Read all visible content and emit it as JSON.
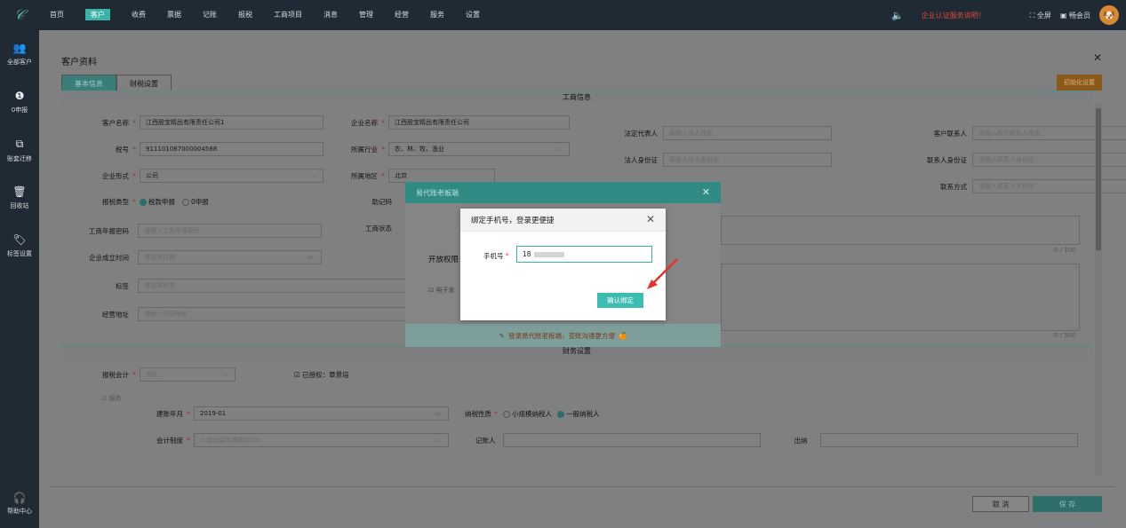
{
  "topbar": {
    "nav": [
      "首页",
      "客户",
      "收费",
      "票据",
      "记账",
      "报税",
      "工商项目",
      "消息",
      "管理",
      "经营",
      "服务",
      "设置"
    ],
    "notice": "企业认证服务说明！",
    "fullscreen": "全屏",
    "member": "畅会员"
  },
  "sidebar": {
    "items": [
      {
        "icon": "users-icon",
        "label": "全部客户"
      },
      {
        "icon": "zero-report-icon",
        "label": "0申报"
      },
      {
        "icon": "transfer-icon",
        "label": "账套迁移"
      },
      {
        "icon": "trash-icon",
        "label": "回收站"
      },
      {
        "icon": "tag-icon",
        "label": "标签设置"
      }
    ],
    "help": "帮助中心"
  },
  "page": {
    "title": "客户资料",
    "tabs": [
      "基本信息",
      "财税设置"
    ],
    "top_button": "初始化设置",
    "section_business": "工商信息",
    "section_finance": "财务设置",
    "fields": {
      "customer_name_label": "客户名称",
      "customer_name": "江西股宝精品有限责任公司1",
      "company_name_label": "企业名称",
      "company_name": "江西股宝精品有限责任公司",
      "legal_rep_label": "法定代表人",
      "legal_rep_ph": "请输入法人姓名",
      "contact_label": "客户联系人",
      "contact_ph": "请输入客户联系人姓名",
      "tax_no_label": "税号",
      "tax_no": "911101087000004588",
      "industry_label": "所属行业",
      "industry": "农、林、牧、渔业",
      "legal_id_label": "法人身份证",
      "legal_id_ph": "请输入法人身份证",
      "contact_id_label": "联系人身份证",
      "contact_id_ph": "请输入联系人身份证",
      "company_type_label": "企业形式",
      "company_type": "公司",
      "region_label": "所属地区",
      "region": "北京",
      "contact_way_label": "联系方式",
      "contact_way_ph": "请输入联系人手机号",
      "report_type_label": "报税类型",
      "report_normal": "税款申报",
      "report_zero": "0申报",
      "mnemonic_label": "助记码",
      "annual_code_label": "工商年报密码",
      "annual_code_ph": "请输入工商年报密码",
      "biz_status_label": "工商状态",
      "found_date_label": "企业成立时间",
      "found_date_ph": "请选择日期",
      "tag_label": "标签",
      "tag_ph": "请选择标签",
      "address_label": "经营地址",
      "address_ph": "请输入经营地址",
      "counter_1": "0 / 100",
      "counter_2": "0 / 500",
      "accountant_label": "报税会计",
      "accountant": "李红",
      "authorized": "已授权：章景培",
      "build_date_label": "建账年月",
      "build_date": "2019-01",
      "taxpayer_label": "纳税性质",
      "taxpayer_small": "小规模纳税人",
      "taxpayer_general": "一般纳税人",
      "account_system_label": "会计制度",
      "account_system": "小企业会计准则2013",
      "bookkeeper_label": "记账人",
      "cashier_label": "出纳",
      "checkbox_label": "服务"
    },
    "cancel": "取 消",
    "save": "保 存"
  },
  "mid_dialog": {
    "title": "易代账老板端",
    "open_perm": "开放权限",
    "checkbox": "电子发",
    "footer_prefix": "登录易代账老板端，查账沟通更方便",
    "footer_icon": "🍊"
  },
  "modal": {
    "title": "绑定手机号，登录更便捷",
    "phone_label": "手机号",
    "phone_value": "18",
    "confirm": "确认绑定"
  }
}
